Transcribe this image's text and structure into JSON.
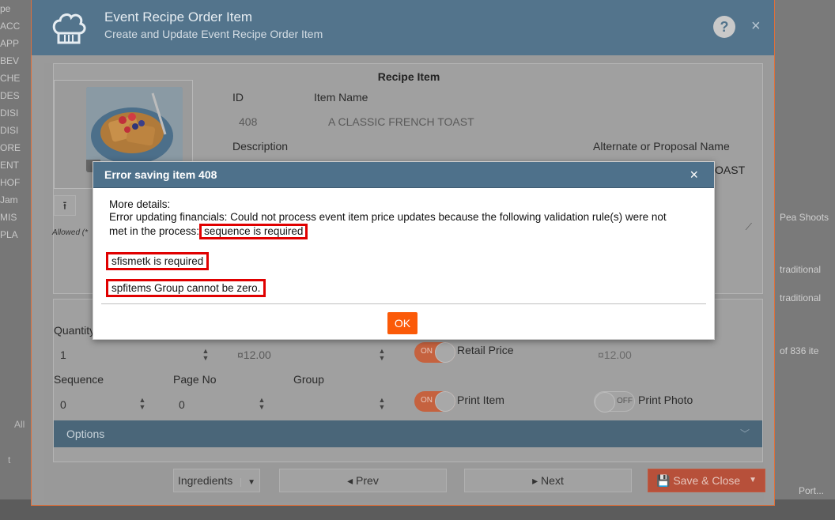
{
  "background": {
    "left_items": [
      "pe",
      "ACC",
      "APP",
      "BEV",
      "CHE",
      "DES",
      "DISI",
      "DISI",
      "ORE",
      "ENT",
      "HOF",
      "Jam",
      "MIS",
      "PLA"
    ],
    "right_items": [
      "Pea Shoots",
      "traditional",
      "traditional",
      "of 836 ite",
      "Port..."
    ],
    "left_tab": "All",
    "left_tab2": "t"
  },
  "modal": {
    "title": "Event Recipe Order Item",
    "subtitle": "Create and Update Event Recipe Order Item",
    "help_glyph": "?",
    "close_glyph": "×",
    "section_title": "Recipe Item",
    "upload_glyph": "⭱",
    "allowed_text": "Allowed (*",
    "labels": {
      "id": "ID",
      "item_name": "Item Name",
      "description": "Description",
      "alternate_name": "Alternate or Proposal Name",
      "quantity": "Quantity",
      "sequence": "Sequence",
      "page_no": "Page No",
      "group": "Group",
      "retail_price": "Retail Price",
      "print_item": "Print Item",
      "print_photo": "Print Photo"
    },
    "values": {
      "id": "408",
      "item_name": "A CLASSIC FRENCH TOAST",
      "alternate_name_partial": "OAST",
      "quantity": "1",
      "price": "¤12.00",
      "retail_price_value": "¤12.00",
      "sequence": "0",
      "page_no": "0",
      "group": ""
    },
    "toggles": {
      "on_text": "ON",
      "off_text": "OFF"
    },
    "options_label": "Options",
    "footer": {
      "ingredients": "Ingredients",
      "prev": "◂ Prev",
      "next": "▸ Next",
      "save_close": "Save & Close"
    }
  },
  "error_dialog": {
    "title": "Error saving item 408",
    "close_glyph": "×",
    "line1": "More details:",
    "line2": "Error updating financials: Could not process event item price updates because the following validation rule(s) were not",
    "line3_prefix": "met in the process:",
    "rule1": "sequence is required",
    "rule2": "sfismetk is required",
    "rule3": "spfitems Group cannot be zero.",
    "ok_label": "OK"
  },
  "colors": {
    "header": "#53748c",
    "ok_button": "#fb5a08",
    "highlight": "#e00000",
    "save_button": "#b7503a"
  }
}
